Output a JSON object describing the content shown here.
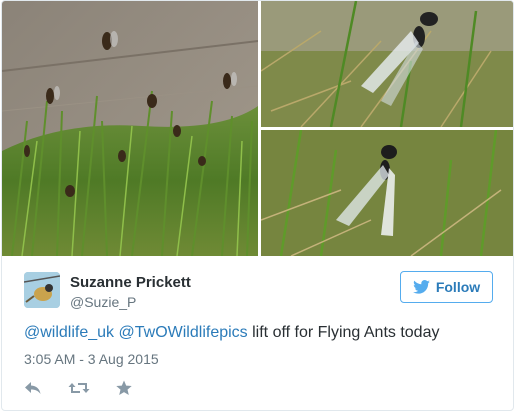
{
  "tweet": {
    "author": {
      "display_name": "Suzanne Prickett",
      "handle": "@Suzie_P",
      "avatar_icon": "bird-avatar"
    },
    "follow_button": {
      "label": "Follow",
      "icon": "twitter-bird-icon"
    },
    "text": {
      "mention_1": "@wildlife_uk",
      "mention_2": "@TwOWildlifepics",
      "body": "lift off for Flying Ants today"
    },
    "timestamp": "3:05 AM - 3 Aug 2015",
    "actions": [
      "reply-icon",
      "retweet-icon",
      "favorite-icon"
    ],
    "photos": [
      {
        "subject": "flying ants emerging from grass on pavement"
      },
      {
        "subject": "winged ant on grass"
      },
      {
        "subject": "winged ant on grass"
      }
    ]
  },
  "colors": {
    "link": "#2b7bb9",
    "follow_border": "#55acee",
    "muted_text": "#66757f",
    "primary_text": "#292f33",
    "action_icon": "#8899a6"
  }
}
